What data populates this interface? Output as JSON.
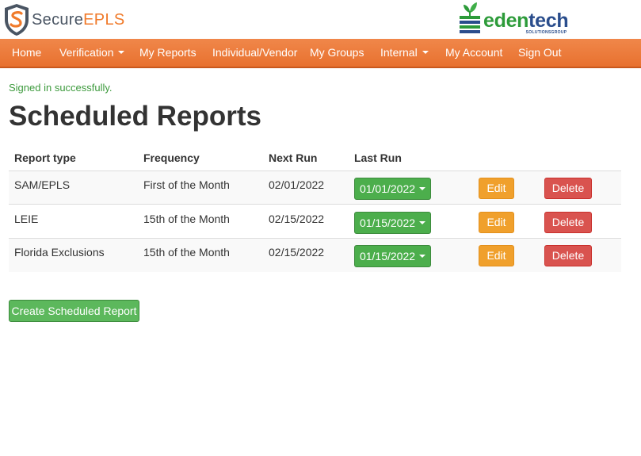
{
  "brand": {
    "left_logo": {
      "icon": "shield-s-icon",
      "text_part1": "Secure",
      "text_part2": "EPLS",
      "colors": {
        "gray": "#4a5563",
        "orange": "#f07a2a"
      }
    },
    "right_logo": {
      "icon": "edentech-stack-icon",
      "text_part1": "eden",
      "text_part2": "tech",
      "subtext": "SOLUTIONSGROUP",
      "colors": {
        "green": "#2d9b3a",
        "blue": "#2a4d8c"
      }
    }
  },
  "nav": {
    "background": "#e8712f",
    "items": [
      {
        "label": "Home",
        "dropdown": false
      },
      {
        "label": "Verification",
        "dropdown": true
      },
      {
        "label": "My Reports",
        "dropdown": false
      },
      {
        "label": "Individual/Vendor",
        "dropdown": false
      },
      {
        "label": "My Groups",
        "dropdown": false
      },
      {
        "label": "Internal",
        "dropdown": true
      },
      {
        "label": "My Account",
        "dropdown": false
      },
      {
        "label": "Sign Out",
        "dropdown": false
      }
    ]
  },
  "flash": "Signed in successfully.",
  "page_title": "Scheduled Reports",
  "table": {
    "headers": [
      "Report type",
      "Frequency",
      "Next Run",
      "Last Run"
    ],
    "rows": [
      {
        "report_type": "SAM/EPLS",
        "frequency": "First of the Month",
        "next_run": "02/01/2022",
        "last_run": "01/01/2022",
        "edit": "Edit",
        "delete": "Delete"
      },
      {
        "report_type": "LEIE",
        "frequency": "15th of the Month",
        "next_run": "02/15/2022",
        "last_run": "01/15/2022",
        "edit": "Edit",
        "delete": "Delete"
      },
      {
        "report_type": "Florida Exclusions",
        "frequency": "15th of the Month",
        "next_run": "02/15/2022",
        "last_run": "01/15/2022",
        "edit": "Edit",
        "delete": "Delete"
      }
    ]
  },
  "create_button": "Create Scheduled Report",
  "colors": {
    "success": "#5cb85c",
    "warning": "#f0a02c",
    "danger": "#d9534f",
    "flash_text": "#3c9a3c"
  }
}
